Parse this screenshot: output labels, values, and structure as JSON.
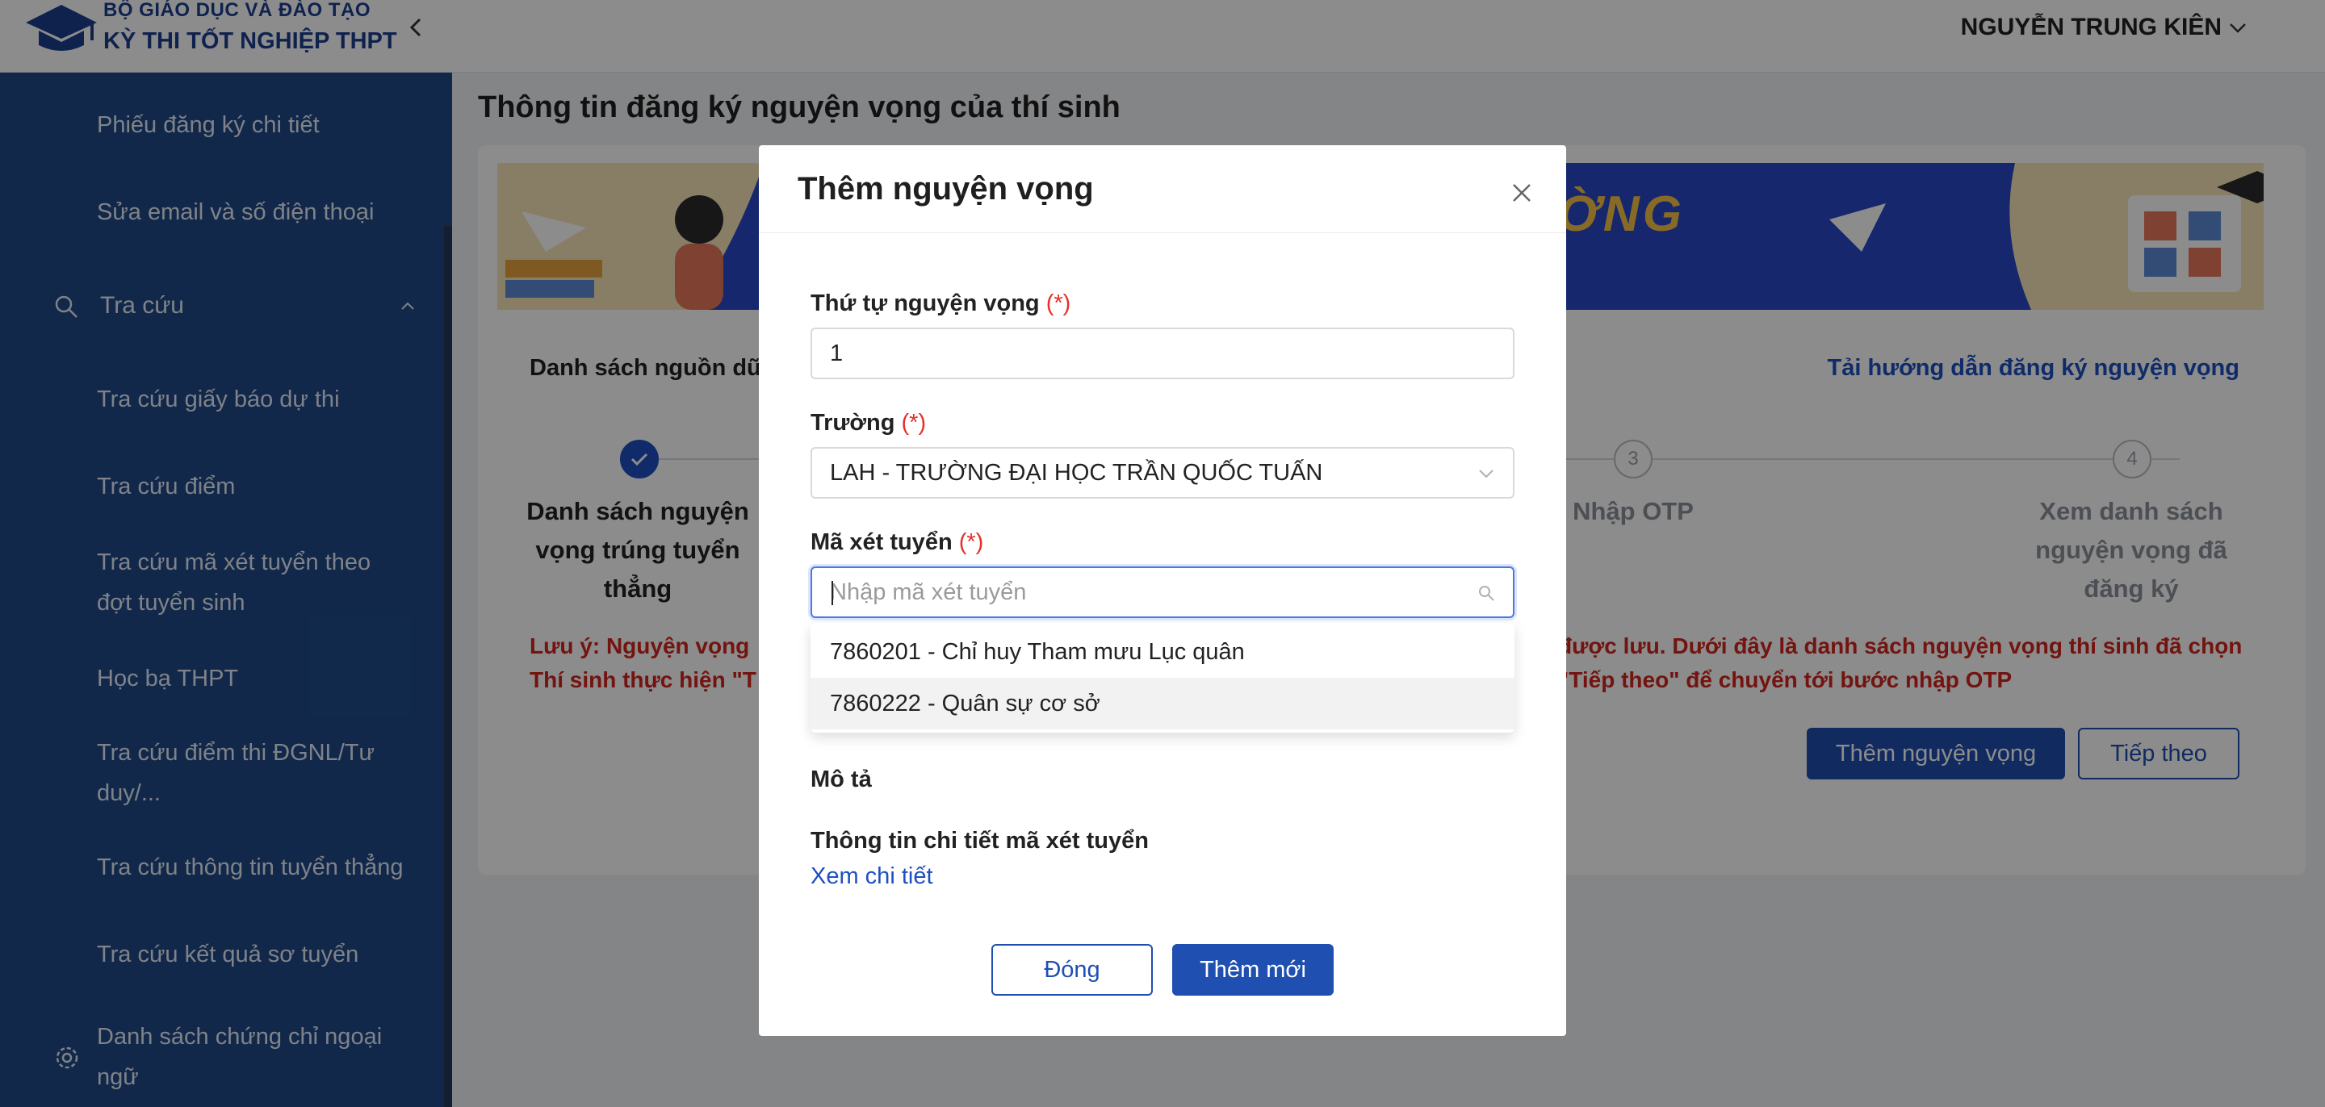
{
  "header": {
    "org_line1": "BỘ GIÁO DỤC VÀ ĐÀO TẠO",
    "org_line2": "KỲ THI TỐT NGHIỆP THPT",
    "user_name": "NGUYỄN TRUNG KIÊN"
  },
  "sidebar": {
    "items_top": [
      "Phiếu đăng ký chi tiết",
      "Sửa email và số điện thoại"
    ],
    "group": "Tra cứu",
    "sub_items": [
      "Tra cứu giấy báo dự thi",
      "Tra cứu điểm",
      "Tra cứu mã xét tuyển theo",
      "đợt tuyển sinh",
      "Học bạ THPT",
      "Tra cứu điểm thi ĐGNL/Tư",
      "duy/...",
      "Tra cứu thông tin tuyển thẳng",
      "Tra cứu kết quả sơ tuyển"
    ],
    "bottom_item_lines": [
      "Danh sách chứng chỉ ngoại",
      "ngữ"
    ]
  },
  "main": {
    "page_title": "Thông tin đăng ký nguyện vọng của thí sinh",
    "banner_text": "ỜNG",
    "list_label": "Danh sách nguồn dữ",
    "guide_link": "Tải hướng dẫn đăng ký nguyện vọng",
    "steps": [
      {
        "num": "",
        "lines": [
          "Danh sách nguyện",
          "vọng trúng tuyển",
          "thẳng"
        ]
      },
      {
        "num": "3",
        "lines": [
          "Nhập OTP"
        ]
      },
      {
        "num": "4",
        "lines": [
          "Xem danh sách",
          "nguyện vọng đã",
          "đăng ký"
        ]
      }
    ],
    "warning_left": [
      "Lưu ý: Nguyện vọng",
      "Thí sinh thực hiện \"T"
    ],
    "warning_right": [
      "được lưu. Dưới đây là danh sách nguyện vọng thí sinh đã chọn",
      "\"Tiếp theo\" để chuyển tới bước nhập OTP"
    ],
    "btn_add": "Thêm nguyện vọng",
    "btn_next": "Tiếp theo"
  },
  "modal": {
    "title": "Thêm nguyện vọng",
    "required_mark": "(*)",
    "order_label": "Thứ tự nguyện vọng",
    "order_value": "1",
    "school_label": "Trường",
    "school_value": "LAH - TRƯỜNG ĐẠI HỌC TRẦN QUỐC TUẤN",
    "code_label": "Mã xét tuyển",
    "code_placeholder": "Nhập mã xét tuyển",
    "options": [
      "7860201 - Chỉ huy Tham mưu Lục quân",
      "7860222 - Quân sự cơ sở"
    ],
    "desc_label": "Mô tả",
    "detail_label": "Thông tin chi tiết mã xét tuyển",
    "detail_link": "Xem chi tiết",
    "btn_close": "Đóng",
    "btn_submit": "Thêm mới"
  },
  "colors": {
    "primary": "#1f4fb0",
    "sidebar": "#1f4a88",
    "warning": "#d1261e",
    "link": "#1d4fbf"
  }
}
